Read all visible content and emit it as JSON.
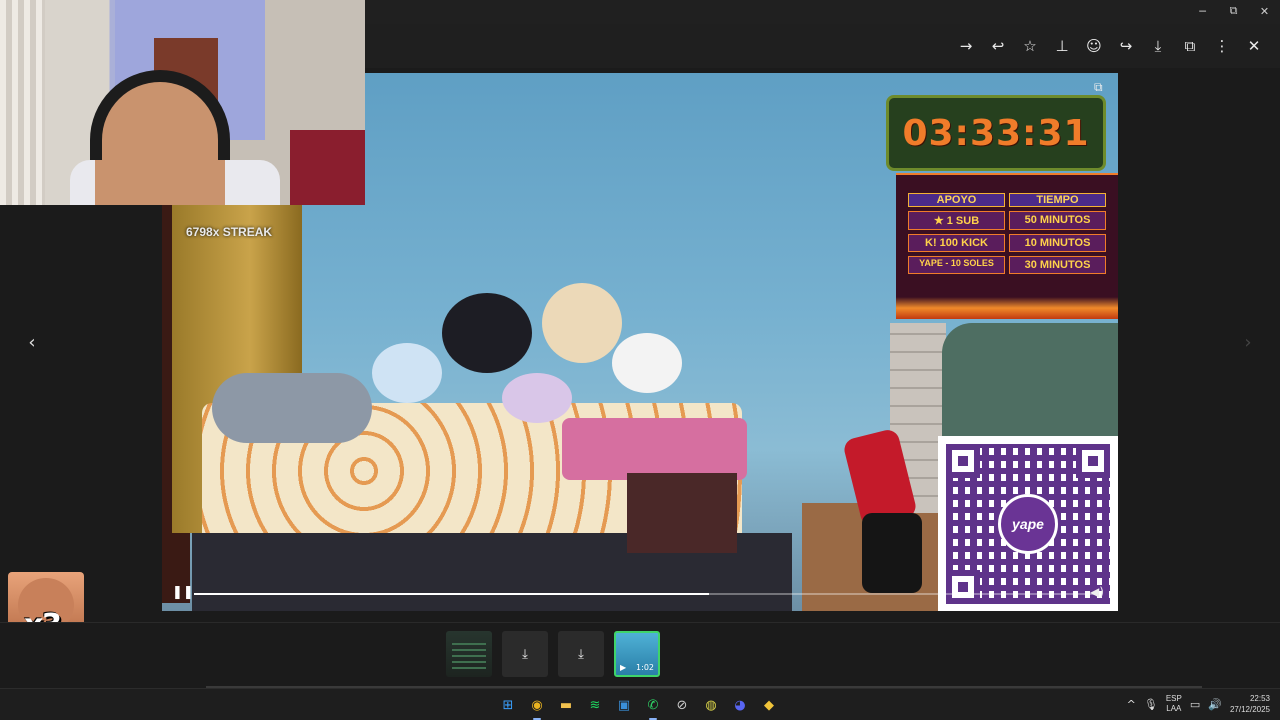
{
  "window": {
    "minimize": "─",
    "maximize": "⧉",
    "close": "✕"
  },
  "toolbar": {
    "icons": [
      {
        "name": "forward-icon",
        "glyph": "→"
      },
      {
        "name": "reply-icon",
        "glyph": "↩"
      },
      {
        "name": "star-icon",
        "glyph": "☆"
      },
      {
        "name": "pin-icon",
        "glyph": "⊥"
      },
      {
        "name": "emoji-icon",
        "glyph": "☺"
      },
      {
        "name": "share-icon",
        "glyph": "↪"
      },
      {
        "name": "download-icon",
        "glyph": "⤓"
      },
      {
        "name": "open-external-icon",
        "glyph": "⧉"
      },
      {
        "name": "more-icon",
        "glyph": "⋮"
      },
      {
        "name": "close-icon",
        "glyph": "✕"
      }
    ]
  },
  "nav": {
    "prev": "‹",
    "next": "›"
  },
  "video": {
    "streak": "6798x STREAK",
    "timer": "03:33:31",
    "popout_glyph": "⧉",
    "progress_fraction": 0.57,
    "pause_glyph": "❚❚",
    "volume_glyph": "◀)",
    "support": {
      "headers": [
        "APOYO",
        "TIEMPO"
      ],
      "rows": [
        [
          "★ 1 SUB",
          "50 MINUTOS"
        ],
        [
          "K! 100 KICK",
          "10 MINUTOS"
        ],
        [
          "YAPE - 10 SOLES",
          "30 MINUTOS"
        ]
      ]
    },
    "qr_logo": "yape"
  },
  "meme": {
    "text": "x3"
  },
  "thumbnails": [
    {
      "kind": "doc",
      "label": ""
    },
    {
      "kind": "download",
      "label": "⤓"
    },
    {
      "kind": "download",
      "label": "⤓"
    },
    {
      "kind": "video",
      "label": "",
      "duration": "1:02"
    }
  ],
  "taskbar": {
    "apps": [
      {
        "name": "windows-start-icon",
        "glyph": "⊞",
        "color": "#3aa0ff"
      },
      {
        "name": "chrome-icon",
        "glyph": "◉",
        "color": "#e9b320"
      },
      {
        "name": "file-explorer-icon",
        "glyph": "▬",
        "color": "#f2c14e"
      },
      {
        "name": "spotify-icon",
        "glyph": "≋",
        "color": "#1ed760"
      },
      {
        "name": "photos-icon",
        "glyph": "▣",
        "color": "#3a8fd9"
      },
      {
        "name": "whatsapp-icon",
        "glyph": "✆",
        "color": "#2fd366"
      },
      {
        "name": "app-icon",
        "glyph": "⊘",
        "color": "#cccccc"
      },
      {
        "name": "app2-icon",
        "glyph": "◍",
        "color": "#d9d34a"
      },
      {
        "name": "discord-icon",
        "glyph": "◕",
        "color": "#5865f2"
      },
      {
        "name": "app3-icon",
        "glyph": "◆",
        "color": "#f0c43a"
      }
    ],
    "tray": {
      "chevron": "^",
      "mic": "🎙",
      "lang_line1": "ESP",
      "lang_line2": "LAA",
      "network": "▭",
      "volume": "🔊",
      "time": "22:53",
      "date": "27/12/2025"
    }
  }
}
